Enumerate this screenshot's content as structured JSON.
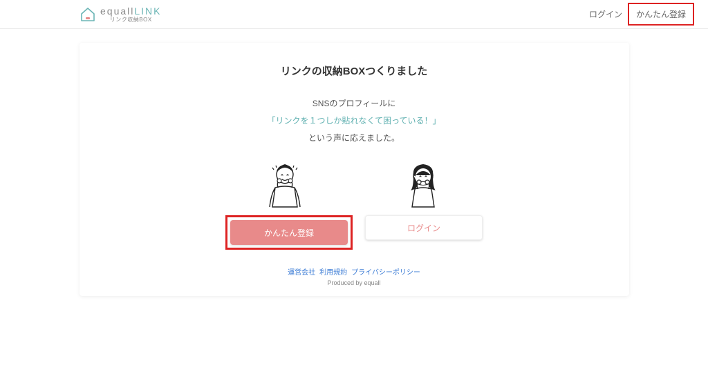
{
  "header": {
    "logo_text_prefix": "equall",
    "logo_text_suffix": "LINK",
    "logo_subtitle": "リンク収納BOX",
    "login_label": "ログイン",
    "register_label": "かんたん登録"
  },
  "main": {
    "title": "リンクの収納BOXつくりました",
    "line1": "SNSのプロフィールに",
    "line2": "「リンクを１つしか貼れなくて困っている！」",
    "line3": "という声に応えました。",
    "register_button": "かんたん登録",
    "login_button": "ログイン"
  },
  "footer": {
    "link1": "運営会社",
    "link2": "利用規約",
    "link3": "プライバシーポリシー",
    "produced": "Produced by equall"
  }
}
